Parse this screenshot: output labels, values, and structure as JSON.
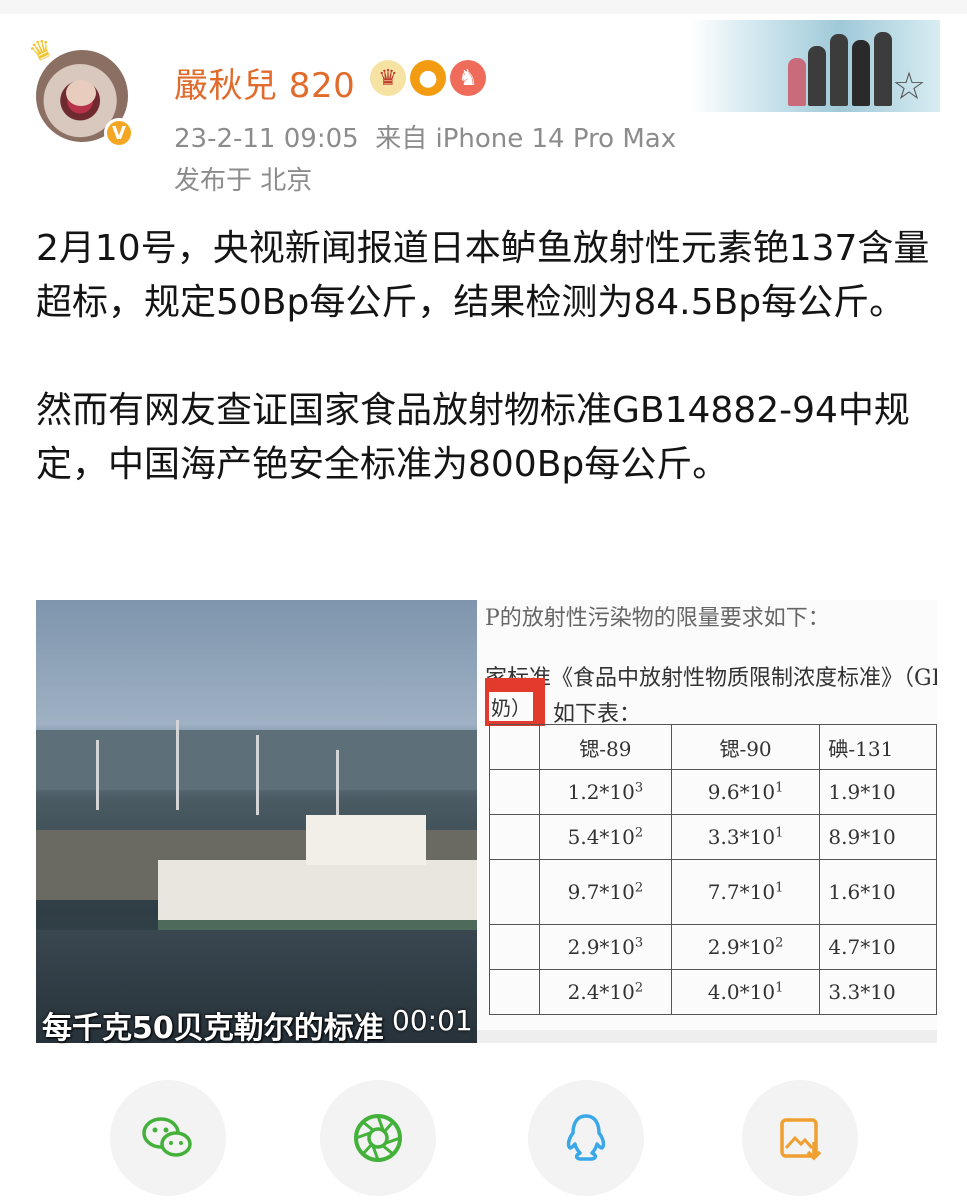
{
  "user": {
    "name": "嚴秋兒 820",
    "post_time": "23-2-11 09:05",
    "source": "来自 iPhone 14 Pro Max",
    "location": "发布于 北京",
    "verified_badge": "V"
  },
  "post": {
    "paragraph1": "2月10号，央视新闻报道日本鲈鱼放射性元素铯137含量超标，规定50Bp每公斤，结果检测为84.5Bp每公斤。",
    "paragraph2": "然而有网友查证国家食品放射物标准GB14882-94中规定，中国海产铯安全标准为800Bp每公斤。"
  },
  "video": {
    "subtitle": "每千克50贝克勒尔的标准",
    "duration": "00:01"
  },
  "document": {
    "line1": "P的放射性污染物的限量要求如下：",
    "line2": "家标准《食品中放射性物质限制浓度标准》（GI",
    "redbox_text": "奶）",
    "line3": "如下表：",
    "headers": [
      "锶-89",
      "锶-90",
      "碘-131"
    ],
    "rows": [
      [
        {
          "base": "1.2*10",
          "exp": "3"
        },
        {
          "base": "9.6*10",
          "exp": "1"
        },
        {
          "base": "1.9*10",
          "exp": ""
        }
      ],
      [
        {
          "base": "5.4*10",
          "exp": "2"
        },
        {
          "base": "3.3*10",
          "exp": "1"
        },
        {
          "base": "8.9*10",
          "exp": ""
        }
      ],
      [
        {
          "base": "9.7*10",
          "exp": "2"
        },
        {
          "base": "7.7*10",
          "exp": "1"
        },
        {
          "base": "1.6*10",
          "exp": ""
        }
      ],
      [
        {
          "base": "2.9*10",
          "exp": "3"
        },
        {
          "base": "2.9*10",
          "exp": "2"
        },
        {
          "base": "4.7*10",
          "exp": ""
        }
      ],
      [
        {
          "base": "2.4*10",
          "exp": "2"
        },
        {
          "base": "4.0*10",
          "exp": "1"
        },
        {
          "base": "3.3*10",
          "exp": ""
        }
      ]
    ]
  },
  "share": [
    {
      "name": "wechat-share-button",
      "icon": "wechat-icon",
      "color": "#43b13a"
    },
    {
      "name": "moments-share-button",
      "icon": "moments-icon",
      "color": "#43b13a"
    },
    {
      "name": "qq-share-button",
      "icon": "qq-icon",
      "color": "#3aa7e8"
    },
    {
      "name": "save-image-button",
      "icon": "save-image-icon",
      "color": "#f0a030"
    }
  ]
}
